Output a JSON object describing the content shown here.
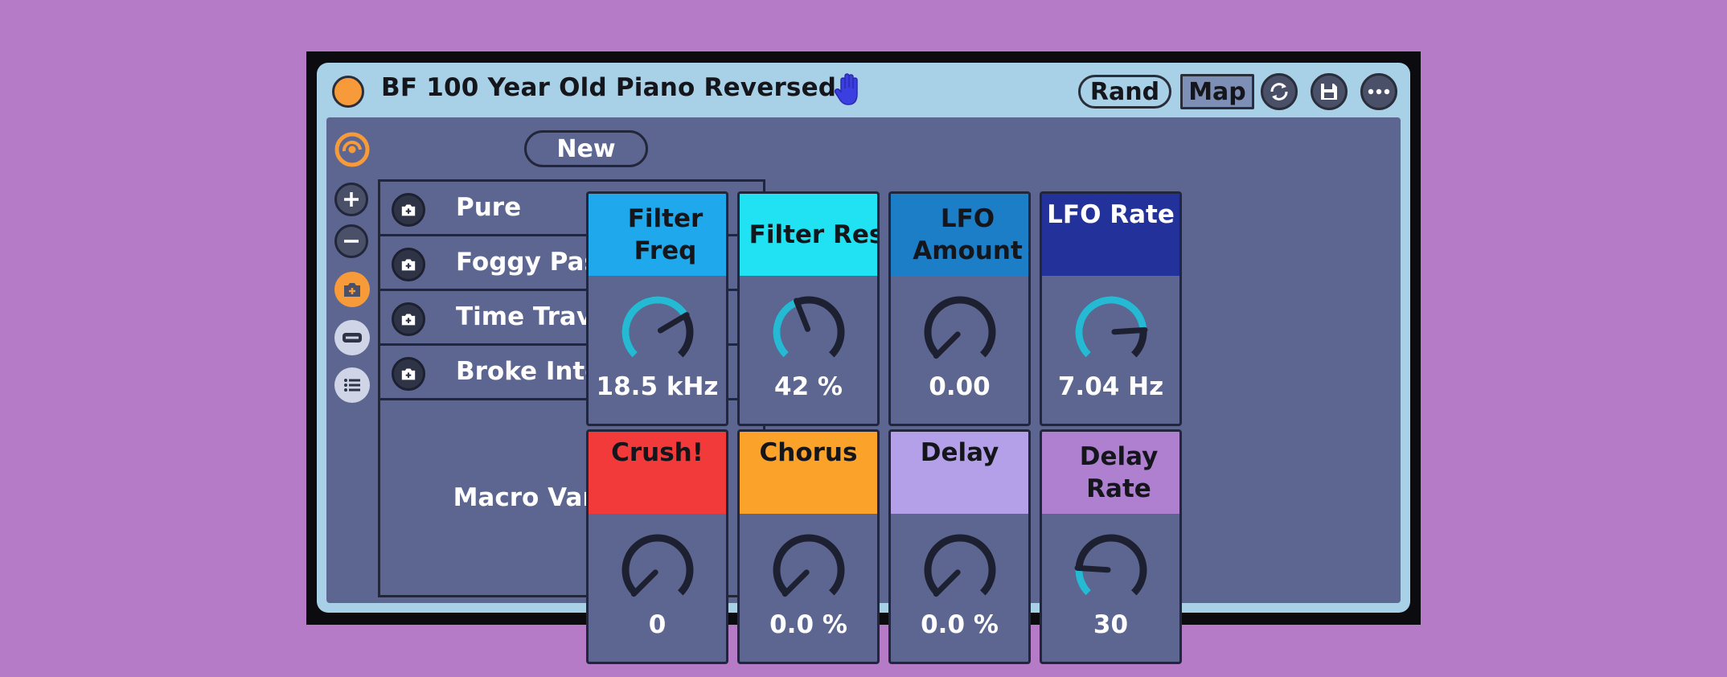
{
  "device": {
    "title": "BF 100 Year Old Piano Reversed",
    "buttons": {
      "rand": "Rand",
      "map": "Map"
    }
  },
  "variations": {
    "new_label": "New",
    "presets": [
      {
        "label": "Pure"
      },
      {
        "label": "Foggy Past"
      },
      {
        "label": "Time Travel"
      },
      {
        "label": "Broke Intelligence"
      }
    ],
    "section_label": "Macro Variations"
  },
  "macros": [
    {
      "label": "Filter Freq",
      "value": "18.5 kHz",
      "color": "#1fa8ec",
      "text_color": "#15161c",
      "level": 0.72
    },
    {
      "label": "Filter Res",
      "value": "42 %",
      "color": "#20e2f2",
      "text_color": "#15161c",
      "level": 0.42
    },
    {
      "label": "LFO Amount",
      "value": "0.00",
      "color": "#1b7ec6",
      "text_color": "#15161c",
      "level": 0.0
    },
    {
      "label": "LFO Rate",
      "value": "7.04 Hz",
      "color": "#23329a",
      "text_color": "#ffffff",
      "level": 0.82
    },
    {
      "label": "Crush!",
      "value": "0",
      "color": "#f23a3a",
      "text_color": "#15161c",
      "level": 0.0
    },
    {
      "label": "Chorus",
      "value": "0.0 %",
      "color": "#fba22a",
      "text_color": "#15161c",
      "level": 0.0
    },
    {
      "label": "Delay",
      "value": "0.0 %",
      "color": "#b3a0e8",
      "text_color": "#15161c",
      "level": 0.0
    },
    {
      "label": "Delay Rate",
      "value": "30",
      "color": "#ae80cf",
      "text_color": "#15161c",
      "level": 0.18
    }
  ],
  "colors": {
    "accent_arc": "#26b9d4",
    "knob_track": "#1d2030",
    "orange": "#f79a3a"
  },
  "icons": [
    "power-icon",
    "hand-icon",
    "sync-icon",
    "save-icon",
    "more-icon",
    "variation-logo-icon",
    "plus-icon",
    "minus-icon",
    "camera-icon",
    "delete-icon",
    "list-icon",
    "play-icon"
  ]
}
